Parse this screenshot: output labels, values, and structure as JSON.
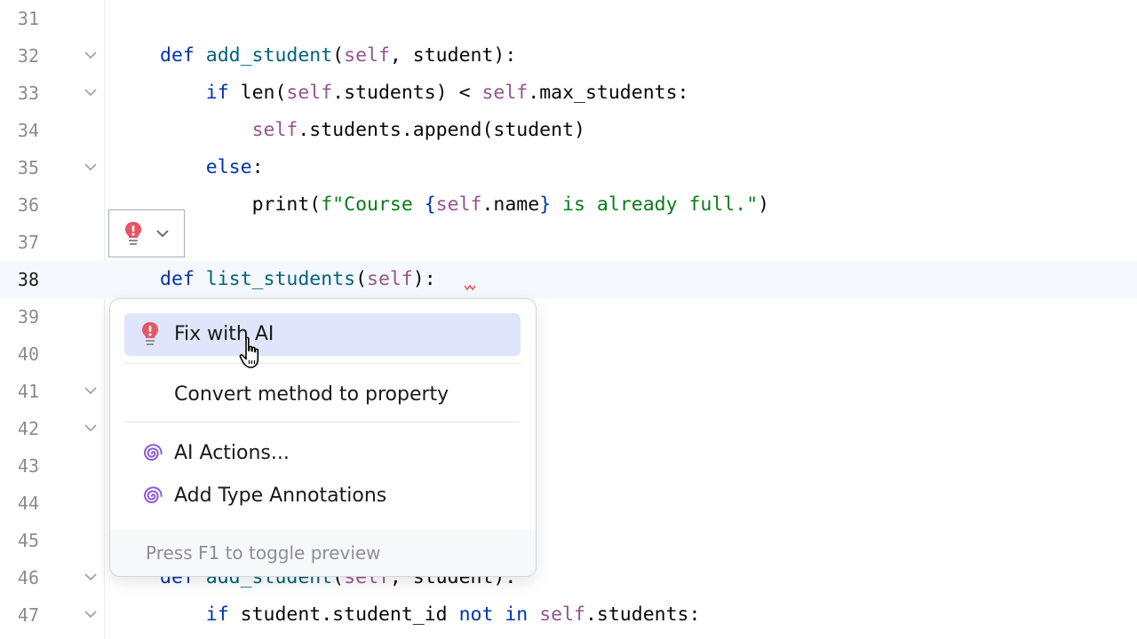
{
  "editor": {
    "lines": [
      {
        "num": "31",
        "fold": false,
        "current": false,
        "tokens": []
      },
      {
        "num": "32",
        "fold": true,
        "current": false,
        "tokens": [
          {
            "t": "def ",
            "c": "kw"
          },
          {
            "t": "add_student",
            "c": "fn"
          },
          {
            "t": "(",
            "c": ""
          },
          {
            "t": "self",
            "c": "slf"
          },
          {
            "t": ", student):",
            "c": ""
          }
        ]
      },
      {
        "num": "33",
        "fold": true,
        "current": false,
        "tokens": [
          {
            "t": "    ",
            "c": ""
          },
          {
            "t": "if ",
            "c": "kw"
          },
          {
            "t": "len(",
            "c": ""
          },
          {
            "t": "self",
            "c": "slf"
          },
          {
            "t": ".students) < ",
            "c": ""
          },
          {
            "t": "self",
            "c": "slf"
          },
          {
            "t": ".max_students:",
            "c": ""
          }
        ]
      },
      {
        "num": "34",
        "fold": false,
        "current": false,
        "tokens": [
          {
            "t": "        ",
            "c": ""
          },
          {
            "t": "self",
            "c": "slf"
          },
          {
            "t": ".students.append(student)",
            "c": ""
          }
        ]
      },
      {
        "num": "35",
        "fold": true,
        "current": false,
        "tokens": [
          {
            "t": "    ",
            "c": ""
          },
          {
            "t": "else",
            "c": "kw"
          },
          {
            "t": ":",
            "c": ""
          }
        ]
      },
      {
        "num": "36",
        "fold": false,
        "current": false,
        "tokens": [
          {
            "t": "        ",
            "c": ""
          },
          {
            "t": "print(",
            "c": ""
          },
          {
            "t": "f\"Course ",
            "c": "str"
          },
          {
            "t": "{",
            "c": "kw"
          },
          {
            "t": "self",
            "c": "slf"
          },
          {
            "t": ".name",
            "c": ""
          },
          {
            "t": "}",
            "c": "kw"
          },
          {
            "t": " is already full.\"",
            "c": "str"
          },
          {
            "t": ")",
            "c": ""
          }
        ]
      },
      {
        "num": "37",
        "fold": false,
        "current": false,
        "tokens": []
      },
      {
        "num": "38",
        "fold": false,
        "current": true,
        "tokens": [
          {
            "t": "def ",
            "c": "kw"
          },
          {
            "t": "list_students",
            "c": "fn"
          },
          {
            "t": "(",
            "c": ""
          },
          {
            "t": "self",
            "c": "slf"
          },
          {
            "t": "):",
            "c": ""
          }
        ]
      },
      {
        "num": "39",
        "fold": false,
        "current": false,
        "tokens": []
      },
      {
        "num": "40",
        "fold": false,
        "current": false,
        "tokens": []
      },
      {
        "num": "41",
        "fold": true,
        "current": false,
        "tokens": []
      },
      {
        "num": "42",
        "fold": true,
        "current": false,
        "tokens": []
      },
      {
        "num": "43",
        "fold": false,
        "current": false,
        "tokens": []
      },
      {
        "num": "44",
        "fold": false,
        "current": false,
        "tokens": []
      },
      {
        "num": "45",
        "fold": false,
        "current": false,
        "tokens": []
      },
      {
        "num": "46",
        "fold": true,
        "current": false,
        "tokens": [
          {
            "t": "def ",
            "c": "kw"
          },
          {
            "t": "add_student",
            "c": "fn"
          },
          {
            "t": "(",
            "c": ""
          },
          {
            "t": "self",
            "c": "slf"
          },
          {
            "t": ", student):",
            "c": ""
          }
        ]
      },
      {
        "num": "47",
        "fold": true,
        "current": false,
        "tokens": [
          {
            "t": "    ",
            "c": ""
          },
          {
            "t": "if ",
            "c": "kw"
          },
          {
            "t": "student.student_id ",
            "c": ""
          },
          {
            "t": "not in ",
            "c": "kw"
          },
          {
            "t": "self",
            "c": "slf"
          },
          {
            "t": ".students:",
            "c": ""
          }
        ]
      }
    ]
  },
  "intention_popup": {
    "items": [
      {
        "label": "Fix with AI",
        "icon": "error-bulb-icon",
        "selected": true
      },
      {
        "label": "Convert method to property",
        "icon": "",
        "selected": false
      },
      {
        "label": "AI Actions...",
        "icon": "ai-spiral-icon",
        "selected": false
      },
      {
        "label": "Add Type Annotations",
        "icon": "ai-spiral-icon",
        "selected": false
      }
    ],
    "footer_hint": "Press F1 to toggle preview"
  },
  "colors": {
    "keyword": "#0033b3",
    "function": "#00627a",
    "self": "#94558d",
    "string": "#067d17",
    "error_bulb": "#e55765",
    "ai_icon": "#8d5bd6",
    "selection": "#dfe6fb"
  }
}
